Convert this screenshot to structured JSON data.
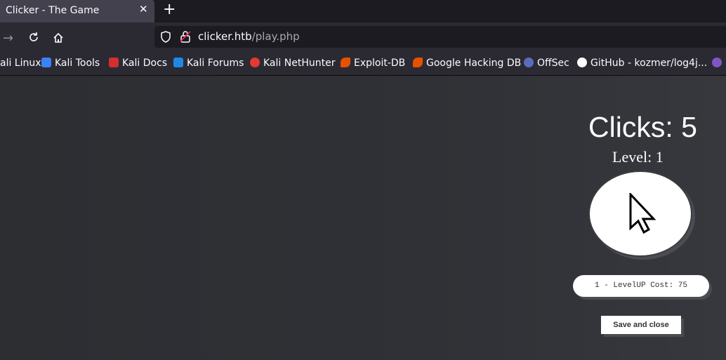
{
  "tab": {
    "title": "Clicker - The Game",
    "close_icon": "close-icon"
  },
  "address_bar": {
    "host": "clicker.htb",
    "path": "/play.php"
  },
  "bookmarks": [
    {
      "label": "ali Linux",
      "color": "#3b82f6"
    },
    {
      "label": "Kali Tools",
      "color": "#3b82f6"
    },
    {
      "label": "Kali Docs",
      "color": "#d32f2f"
    },
    {
      "label": "Kali Forums",
      "color": "#1e88e5"
    },
    {
      "label": "Kali NetHunter",
      "color": "#e53935"
    },
    {
      "label": "Exploit-DB",
      "color": "#e65100"
    },
    {
      "label": "Google Hacking DB",
      "color": "#e65100"
    },
    {
      "label": "OffSec",
      "color": "#5c6bc0"
    },
    {
      "label": "GitHub - kozmer/log4j...",
      "color": "#ffffff"
    }
  ],
  "game": {
    "clicks_label": "Clicks: 5",
    "level_label": "Level: 1",
    "levelup_label": "1 - LevelUP Cost: 75",
    "save_label": "Save and close"
  }
}
